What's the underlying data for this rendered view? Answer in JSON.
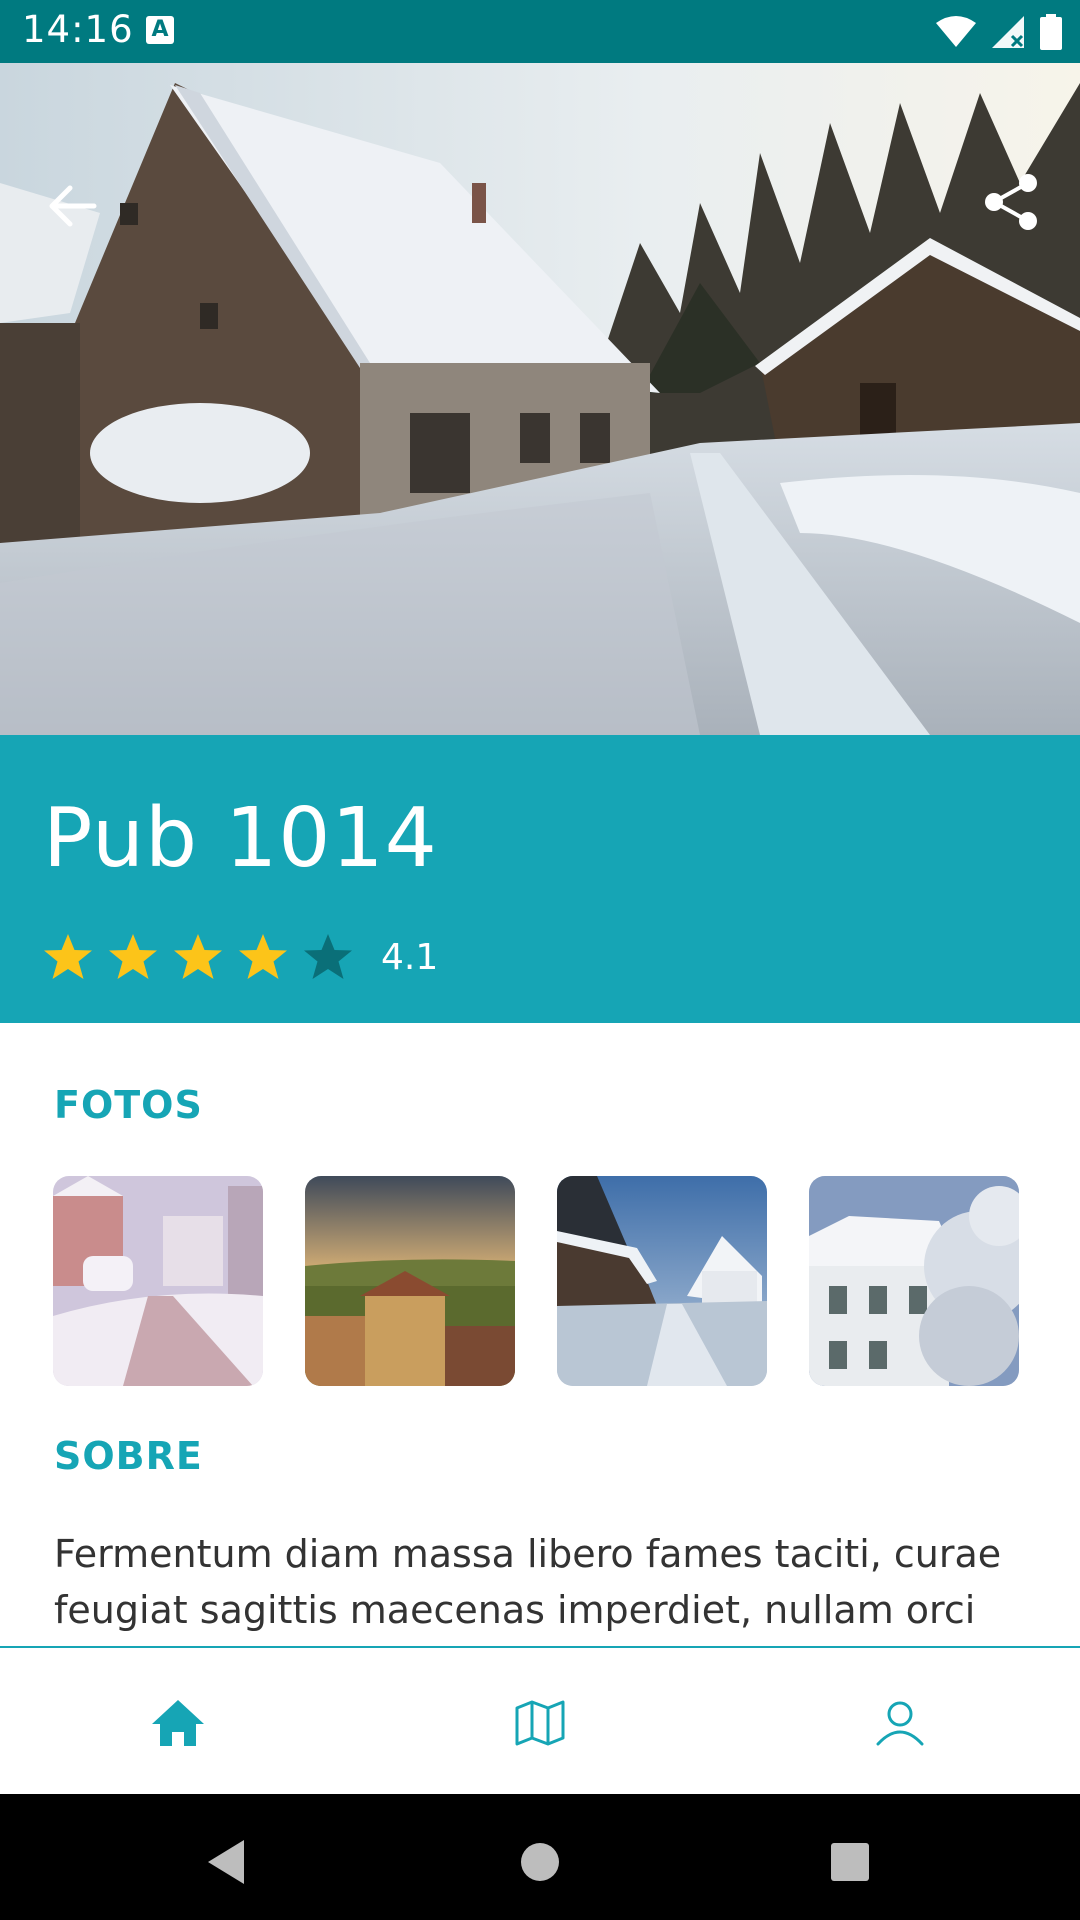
{
  "status_bar": {
    "time": "14:16",
    "notification_icon": "text-a-icon",
    "icons": [
      "wifi-icon",
      "signal-icon",
      "battery-icon"
    ]
  },
  "header": {
    "back_icon": "arrow-left-icon",
    "share_icon": "share-icon"
  },
  "place": {
    "title": "Pub 1014",
    "rating": 4.1,
    "rating_text": "4.1",
    "stars_filled": 4,
    "stars_total": 5
  },
  "sections": {
    "photos_title": "FOTOS",
    "about_title": "SOBRE"
  },
  "photos": [
    {
      "name": "snowy-street-photo"
    },
    {
      "name": "village-sunset-photo"
    },
    {
      "name": "snowy-road-houses-photo"
    },
    {
      "name": "snowy-house-trees-photo"
    }
  ],
  "about": {
    "text": "Fermentum diam massa libero fames taciti, curae feugiat sagittis maecenas imperdiet, nullam orci"
  },
  "bottom_nav": {
    "items": [
      {
        "icon": "home-icon",
        "active": true
      },
      {
        "icon": "map-icon",
        "active": false
      },
      {
        "icon": "profile-icon",
        "active": false
      }
    ]
  },
  "colors": {
    "status_bar": "#007a80",
    "accent": "#16a5b5",
    "star_filled": "#fcc419",
    "star_empty": "#0a6f78",
    "text": "#333333"
  }
}
